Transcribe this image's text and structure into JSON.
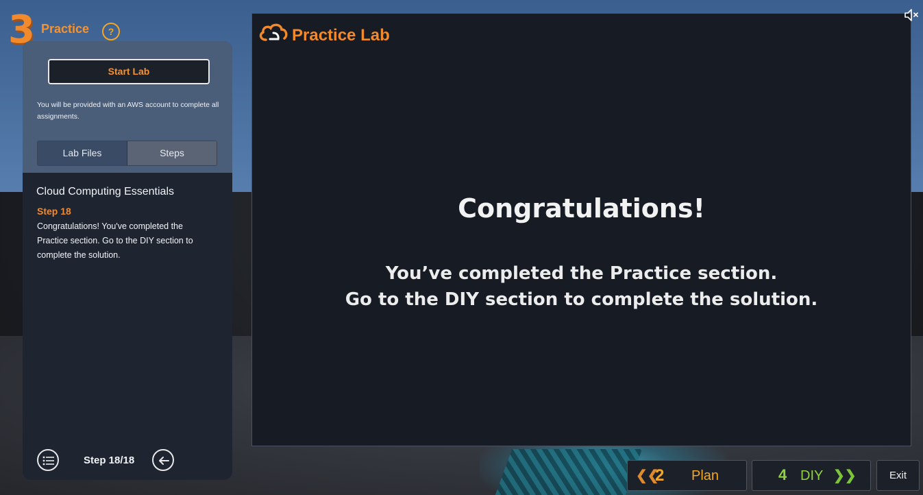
{
  "header": {
    "section_number": "3",
    "section_title": "Practice",
    "help_symbol": "?"
  },
  "left_panel": {
    "start_button": "Start Lab",
    "note": "You will be provided with an AWS account to complete all assignments.",
    "tabs": [
      {
        "label": "Lab Files",
        "active": false
      },
      {
        "label": "Steps",
        "active": true
      }
    ],
    "course_title": "Cloud Computing Essentials",
    "step_label": "Step 18",
    "step_text": "Congratulations! You've completed the Practice section. Go to the DIY section to complete the solution.",
    "step_counter": "Step 18/18"
  },
  "lab": {
    "title": "Practice Lab",
    "heading": "Congratulations!",
    "message_line1": "You’ve completed the Practice section.",
    "message_line2": "Go to the DIY section to complete the solution."
  },
  "nav": {
    "prev_number": "2",
    "prev_label": "Plan",
    "next_number": "4",
    "next_label": "DIY",
    "exit_label": "Exit"
  },
  "icons": {
    "help": "help-icon",
    "list": "list-icon",
    "back": "back-arrow-icon",
    "mute": "mute-icon",
    "logo": "cloud-logo-icon",
    "prev": "double-chevron-left-icon",
    "next": "double-chevron-right-icon"
  },
  "colors": {
    "accent_orange": "#f08a2c",
    "accent_green": "#8fd142",
    "panel_dark": "#161b24"
  }
}
